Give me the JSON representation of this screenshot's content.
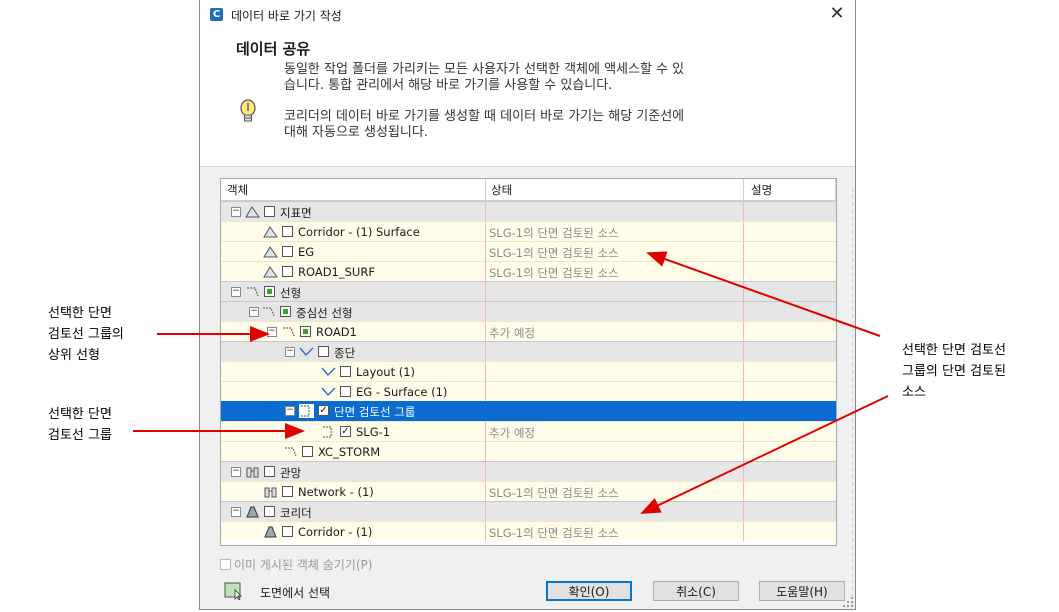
{
  "window": {
    "title": "데이터 바로 가기 작성",
    "app_icon": "C"
  },
  "header": {
    "title": "데이터 공유",
    "desc_line1": "동일한 작업 폴더를 가리키는 모든 사용자가 선택한 객체에 액세스할 수 있",
    "desc_line2": "습니다. 통합 관리에서 해당 바로 가기를 사용할 수 있습니다.",
    "tip_line1": "코리더의 데이터 바로 가기를 생성할 때 데이터 바로 가기는 해당 기준선에",
    "tip_line2": "대해 자동으로 생성됩니다."
  },
  "columns": [
    "객체",
    "상태",
    "설명"
  ],
  "tree": [
    {
      "label": "지표면",
      "status": ""
    },
    {
      "label": "Corridor - (1) Surface",
      "status": "SLG-1의 단면 검토된 소스"
    },
    {
      "label": "EG",
      "status": "SLG-1의 단면 검토된 소스"
    },
    {
      "label": "ROAD1_SURF",
      "status": "SLG-1의 단면 검토된 소스"
    },
    {
      "label": "선형",
      "status": ""
    },
    {
      "label": "중심선 선형",
      "status": ""
    },
    {
      "label": "ROAD1",
      "status": "추가 예정"
    },
    {
      "label": "종단",
      "status": ""
    },
    {
      "label": "Layout (1)",
      "status": ""
    },
    {
      "label": "EG - Surface (1)",
      "status": ""
    },
    {
      "label": "단면 검토선 그룹",
      "status": ""
    },
    {
      "label": "SLG-1",
      "status": "추가 예정"
    },
    {
      "label": "XC_STORM",
      "status": ""
    },
    {
      "label": "관망",
      "status": ""
    },
    {
      "label": "Network - (1)",
      "status": "SLG-1의 단면 검토된 소스"
    },
    {
      "label": "코리더",
      "status": ""
    },
    {
      "label": "Corridor - (1)",
      "status": "SLG-1의 단면 검토된 소스"
    }
  ],
  "options": {
    "hide_shared": "이미 게시된 객체 숨기기(P)"
  },
  "footer": {
    "pick_label": "도면에서 선택",
    "ok": "확인(O)",
    "cancel": "취소(C)",
    "help": "도움말(H)"
  },
  "annotations": {
    "left1": [
      "선택한 단면",
      "검토선 그룹의",
      "상위 선형"
    ],
    "left2": [
      "선택한 단면",
      "검토선 그룹"
    ],
    "right": [
      "선택한 단면 검토선",
      "그룹의 단면 검토된",
      "소스"
    ]
  },
  "colors": {
    "selection": "#0a6cd0",
    "arrow": "#e00000",
    "accent": "#0078d7"
  }
}
